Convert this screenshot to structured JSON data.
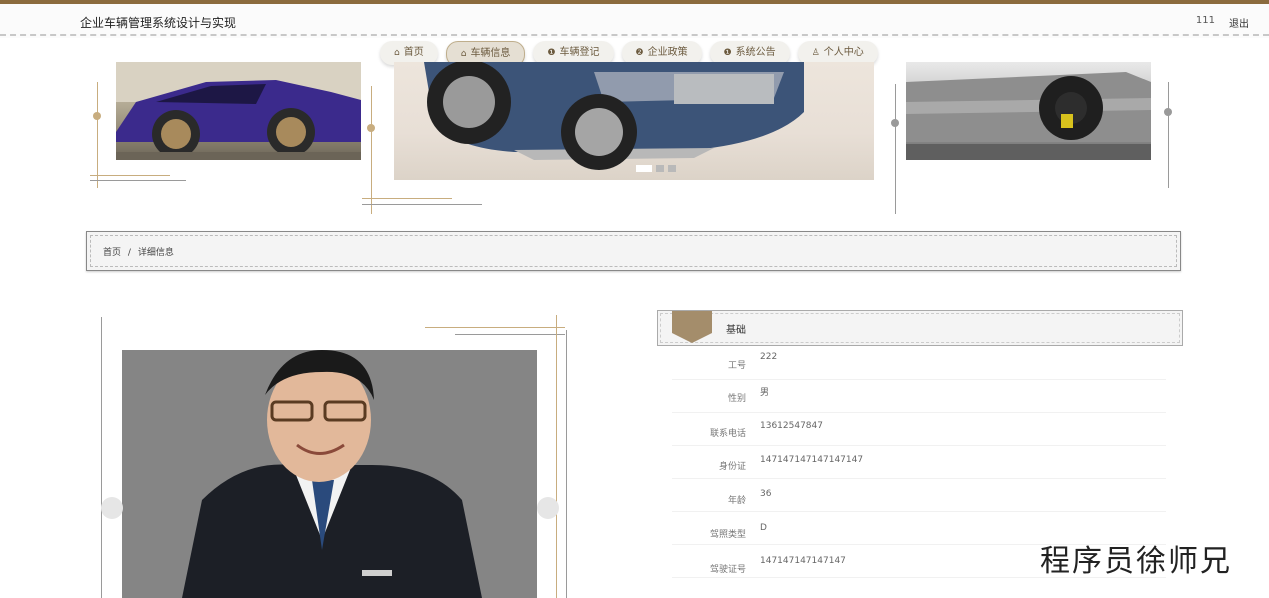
{
  "header": {
    "site_title": "企业车辆管理系统设计与实现",
    "username": "111",
    "logout_label": "退出"
  },
  "nav": {
    "items": [
      {
        "icon": "home-icon",
        "glyph": "⌂",
        "label": "首页"
      },
      {
        "icon": "car-icon",
        "glyph": "⌂",
        "label": "车辆信息"
      },
      {
        "icon": "info-icon",
        "glyph": "❶",
        "label": "车辆登记"
      },
      {
        "icon": "policy-icon",
        "glyph": "❷",
        "label": "企业政策"
      },
      {
        "icon": "notice-icon",
        "glyph": "❶",
        "label": "系统公告"
      },
      {
        "icon": "user-icon",
        "glyph": "♙",
        "label": "个人中心"
      }
    ],
    "active_index": 1
  },
  "carousel": {
    "slides": [
      "purple-sports-car",
      "blue-sedan",
      "silver-sports-car"
    ],
    "active_slide": 0,
    "indicator_count": 3
  },
  "breadcrumb": {
    "home": "首页",
    "separator": "/",
    "current": "详细信息"
  },
  "profile": {
    "section_title": "基础",
    "rows": [
      {
        "label": "工号",
        "value": "222"
      },
      {
        "label": "性别",
        "value": "男"
      },
      {
        "label": "联系电话",
        "value": "13612547847"
      },
      {
        "label": "身份证",
        "value": "147147147147147147"
      },
      {
        "label": "年龄",
        "value": "36"
      },
      {
        "label": "驾照类型",
        "value": "D"
      },
      {
        "label": "驾驶证号",
        "value": "147147147147147"
      }
    ]
  },
  "watermark": "程序员徐师兄",
  "colors": {
    "accent": "#8b6b3e",
    "decor_gold": "#c8ad7f"
  }
}
